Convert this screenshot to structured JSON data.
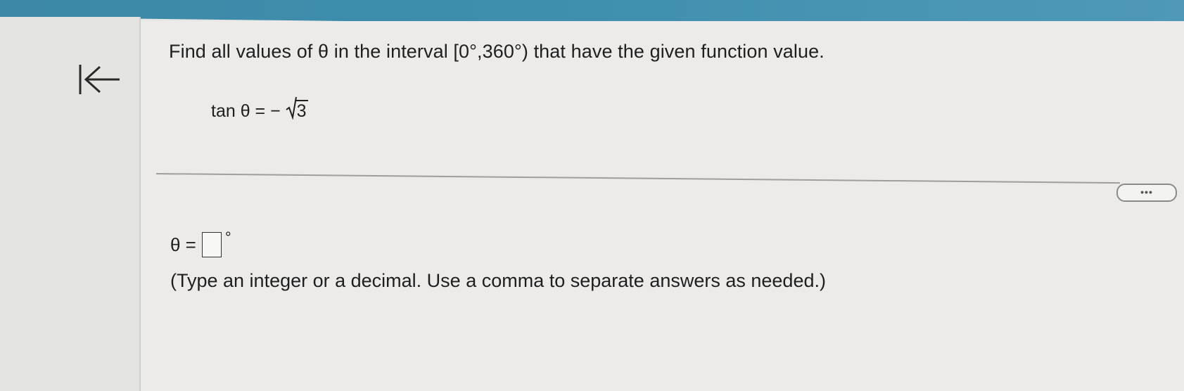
{
  "window": {
    "top_bar_color": "#3f8eae",
    "background": "#ecebe9"
  },
  "nav": {
    "back_icon": "first-page-arrow-icon"
  },
  "question": {
    "prompt": "Find all values of θ in the interval [0°,360°) that have the given function value.",
    "equation_lhs": "tan θ = −",
    "equation_radicand": "3"
  },
  "toolbar": {
    "more_label": "•••"
  },
  "answer": {
    "variable_label": "θ =",
    "value": "",
    "unit": "°",
    "instructions": "(Type an integer or a decimal. Use a comma to separate answers as needed.)"
  }
}
